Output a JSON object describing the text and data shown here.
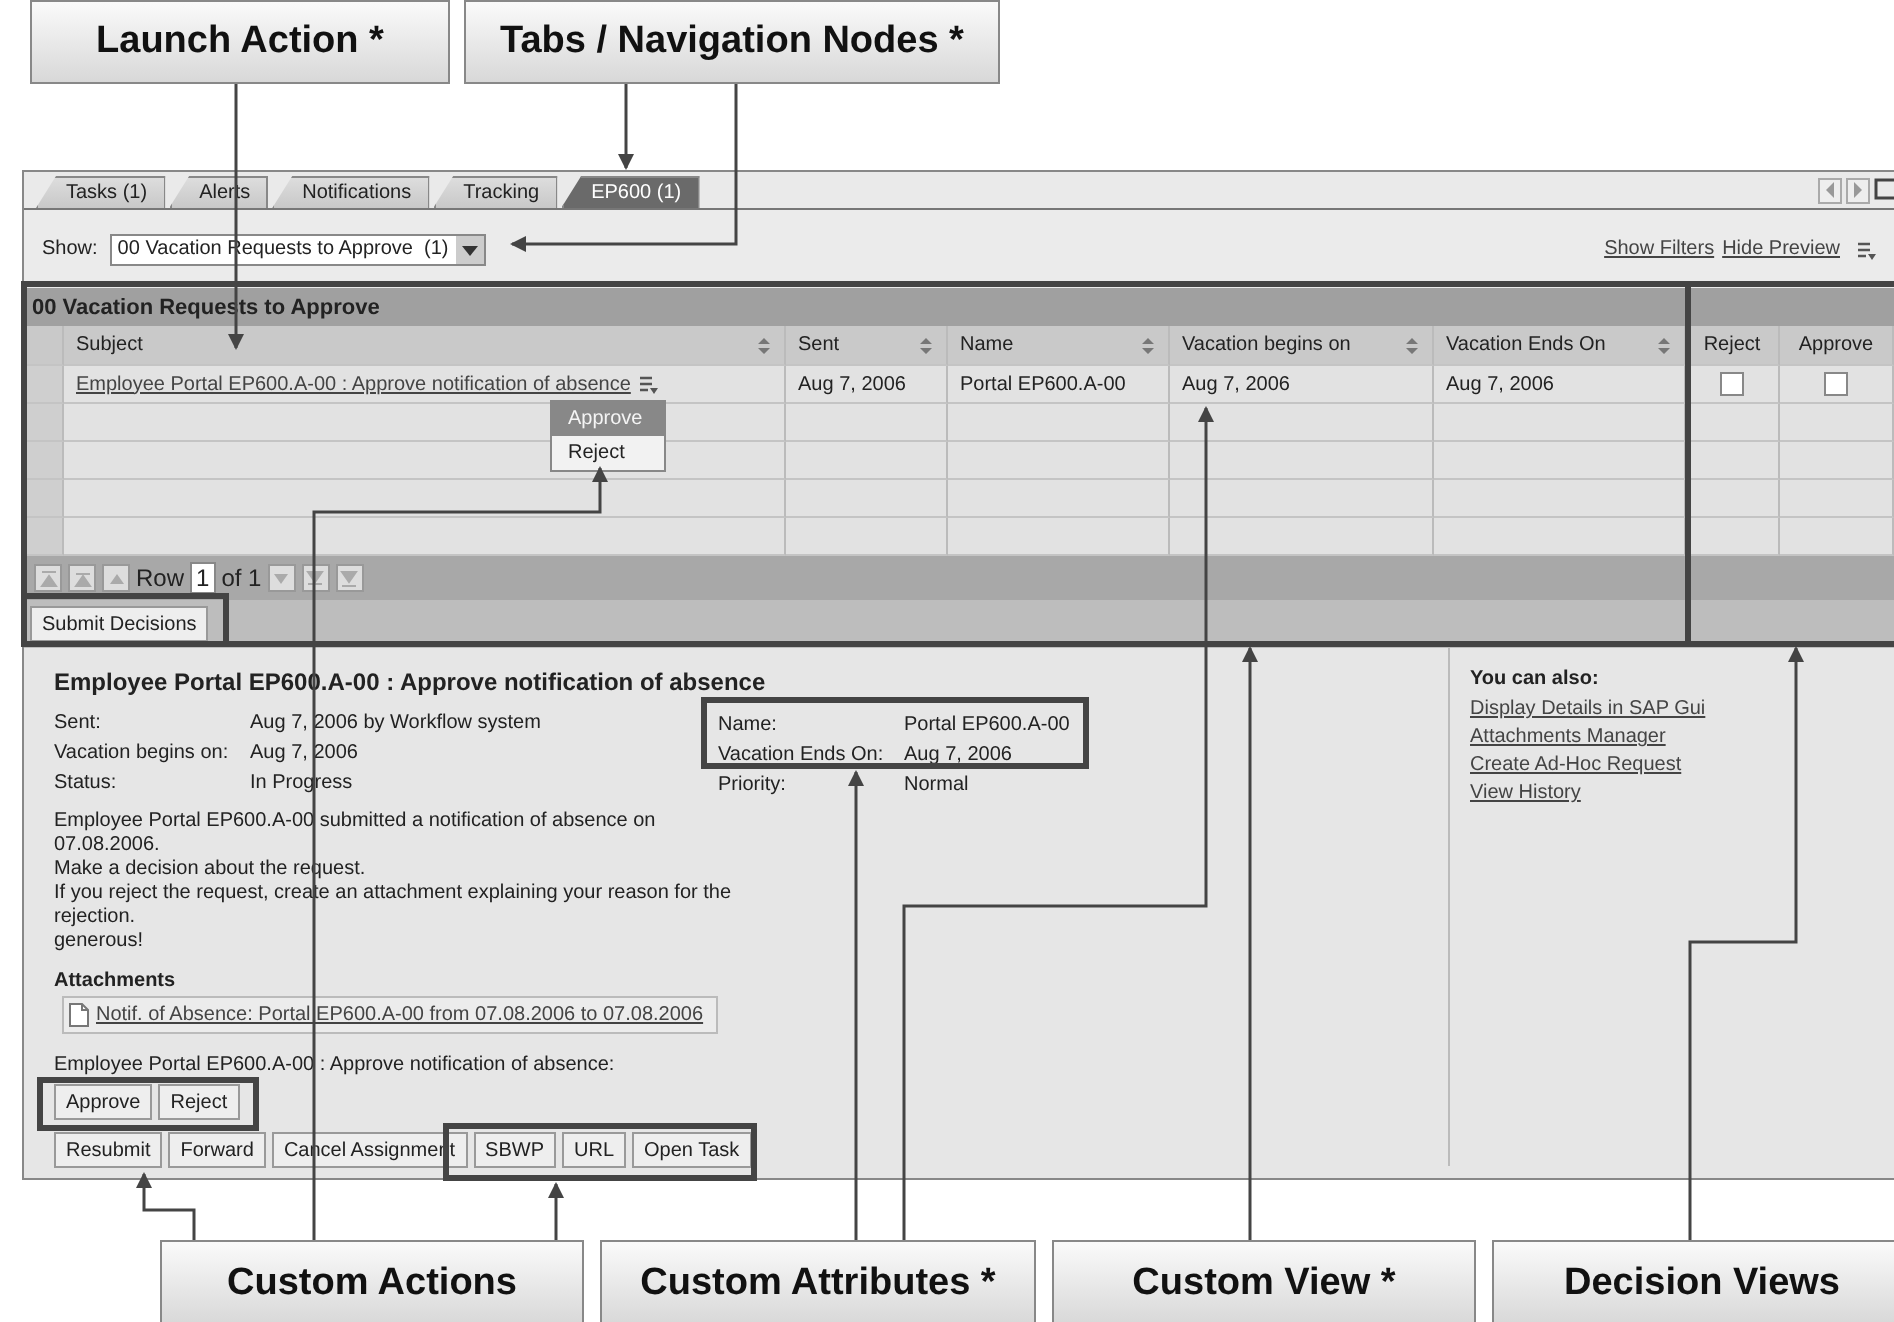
{
  "callouts_top": [
    {
      "label": "Launch Action *"
    },
    {
      "label": "Tabs / Navigation Nodes *"
    }
  ],
  "tabs": [
    {
      "label": "Tasks (1)",
      "selected": false
    },
    {
      "label": "Alerts",
      "selected": false
    },
    {
      "label": "Notifications",
      "selected": false
    },
    {
      "label": "Tracking",
      "selected": false
    },
    {
      "label": "EP600 (1)",
      "selected": true
    }
  ],
  "show": {
    "label": "Show:",
    "value": "00 Vacation Requests to Approve  (1)"
  },
  "view_links": [
    "Show Filters",
    "Hide Preview"
  ],
  "table": {
    "title": "00 Vacation Requests to Approve",
    "columns": [
      "Subject",
      "Sent",
      "Name",
      "Vacation begins on",
      "Vacation Ends On"
    ],
    "decision_columns": [
      "Reject",
      "Approve"
    ],
    "rows": [
      {
        "cells": [
          "Employee Portal EP600.A-00 : Approve notification of absence",
          "Aug 7, 2006",
          "Portal EP600.A-00",
          "Aug 7, 2006",
          "Aug 7, 2006"
        ],
        "decisions": [
          {
            "checked": false
          },
          {
            "checked": false
          }
        ]
      }
    ],
    "pager": {
      "label": "Row",
      "value": "1",
      "total": "of 1"
    }
  },
  "context_menu": [
    {
      "label": "Approve",
      "selected": true
    },
    {
      "label": "Reject",
      "selected": false
    }
  ],
  "submit_button": "Submit Decisions",
  "preview": {
    "title": "Employee Portal EP600.A-00 : Approve notification of absence",
    "attributes_left": [
      {
        "label": "Sent:",
        "value": "Aug 7, 2006 by Workflow system"
      },
      {
        "label": "Vacation begins on:",
        "value": "Aug 7, 2006"
      },
      {
        "label": "Status:",
        "value": "In Progress"
      }
    ],
    "attributes_right": [
      {
        "label": "Name:",
        "value": "Portal EP600.A-00"
      },
      {
        "label": "Vacation Ends On:",
        "value": "Aug 7, 2006"
      },
      {
        "label": "Priority:",
        "value": "Normal"
      }
    ],
    "description": [
      "Employee Portal EP600.A-00 submitted a notification of absence on 07.08.2006.",
      "Make a decision about the request.",
      "If you reject the request, create an attachment explaining your reason for the rejection.",
      "generous!"
    ],
    "attachments_heading": "Attachments",
    "attachment": "Notif. of Absence: Portal EP600.A-00 from 07.08.2006 to 07.08.2006",
    "decision_text": "Employee Portal EP600.A-00 : Approve notification of absence:",
    "decision_buttons": [
      "Approve",
      "Reject"
    ],
    "action_buttons": [
      "Resubmit",
      "Forward",
      "Cancel Assignment",
      "SBWP",
      "URL",
      "Open Task"
    ],
    "side_heading": "You can also:",
    "side_links": [
      "Display Details in SAP Gui",
      "Attachments Manager",
      "Create Ad-Hoc Request",
      "View History"
    ]
  },
  "callouts_bottom": [
    {
      "label": "Custom Actions"
    },
    {
      "label": "Custom Attributes *"
    },
    {
      "label": "Custom View *"
    },
    {
      "label": "Decision Views"
    }
  ]
}
